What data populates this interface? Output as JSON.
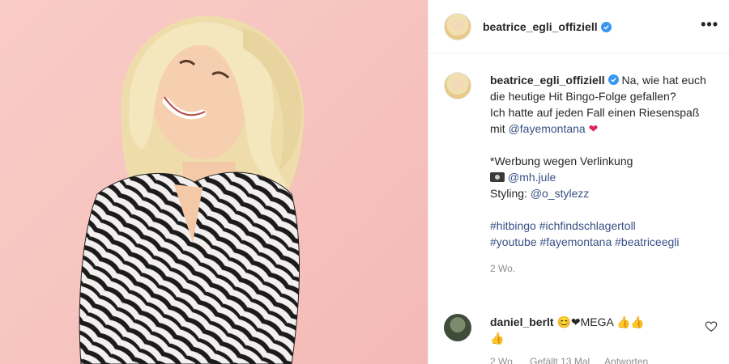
{
  "header": {
    "username": "beatrice_egli_offiziell",
    "more_label": "•••"
  },
  "caption": {
    "username": "beatrice_egli_offiziell",
    "line1": "Na, wie hat euch die heutige Hit Bingo-Folge gefallen?",
    "line2_prefix": "Ich hatte auf jeden Fall einen Riesenspaß mit ",
    "mention_faye": "@fayemontana",
    "heart": "❤",
    "werbung": "*Werbung wegen Verlinkung",
    "photo_credit": "@mh.jule",
    "styling_label": "Styling: ",
    "styling_credit": "@o_stylezz",
    "hashtags_line1": "#hitbingo #ichfindschlagertoll",
    "hashtags_line2": "#youtube #fayemontana #beatriceegli",
    "time": "2 Wo."
  },
  "comment": {
    "username": "daniel_berlt",
    "text": "😊❤MEGA 👍👍",
    "text_cont": "👍",
    "meta_time": "2 Wo.",
    "meta_likes": "Gefällt 13 Mal",
    "meta_reply": "Antworten"
  },
  "colors": {
    "verified": "#3897f0",
    "link": "#385185",
    "background_photo": "#f7c5c0"
  }
}
